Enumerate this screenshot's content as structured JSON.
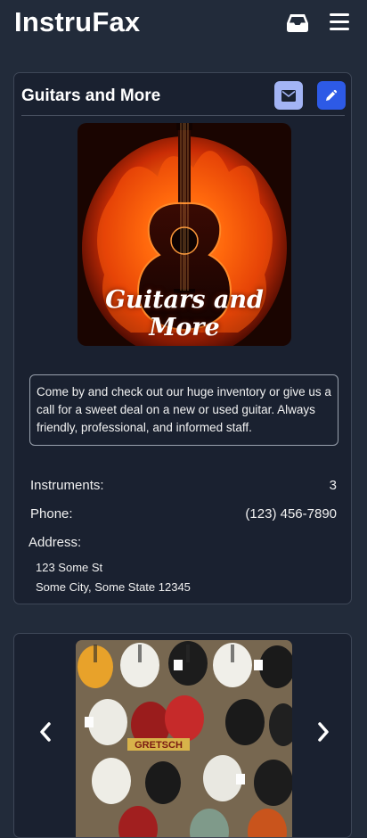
{
  "app": {
    "title": "InstruFax"
  },
  "header": {
    "inbox_icon": "inbox-icon",
    "menu_icon": "hamburger-menu-icon"
  },
  "store": {
    "name": "Guitars and More",
    "logo_text": "Guitars and More",
    "description": "Come by and check out our huge inventory or give us a call for a sweet deal on a new or used guitar. Always friendly, professional, and informed staff.",
    "instruments_label": "Instruments:",
    "instruments_value": "3",
    "phone_label": "Phone:",
    "phone_value": "(123) 456-7890",
    "address_label": "Address:",
    "address_line1": "123 Some St",
    "address_line2": "Some City, Some State 12345"
  },
  "actions": {
    "mail_icon": "envelope-icon",
    "edit_icon": "pencil-icon"
  },
  "carousel": {
    "prev_icon": "chevron-left-icon",
    "next_icon": "chevron-right-icon",
    "sign_text": "GRETSCH"
  },
  "colors": {
    "background": "#222b3a",
    "card": "#1a2130",
    "mail_button": "#a3b4f5",
    "edit_button": "#2d5ae6",
    "text": "#ffffff"
  }
}
